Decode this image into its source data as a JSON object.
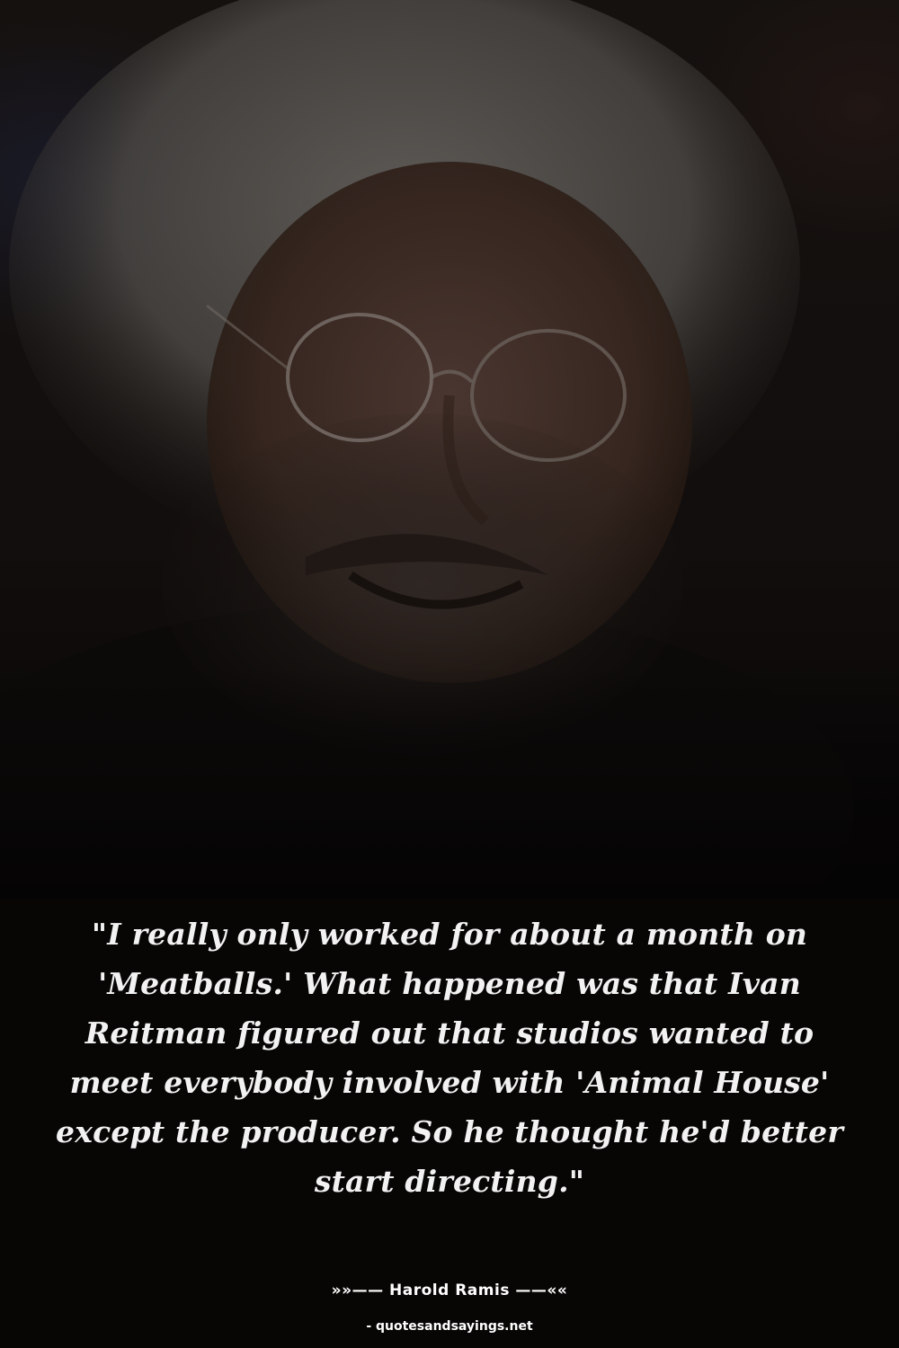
{
  "quote": {
    "text": "\"I really only worked for about a month on 'Meatballs.' What happened was that Ivan Reitman figured out that studios wanted to meet everybody involved with 'Animal House' except the producer. So he thought he'd better start directing.\""
  },
  "attribution": {
    "author_line": "»»—— Harold Ramis ——««",
    "source": "- quotesandsayings.net"
  },
  "colors": {
    "background": "#070605",
    "text": "#f2f2f2"
  }
}
